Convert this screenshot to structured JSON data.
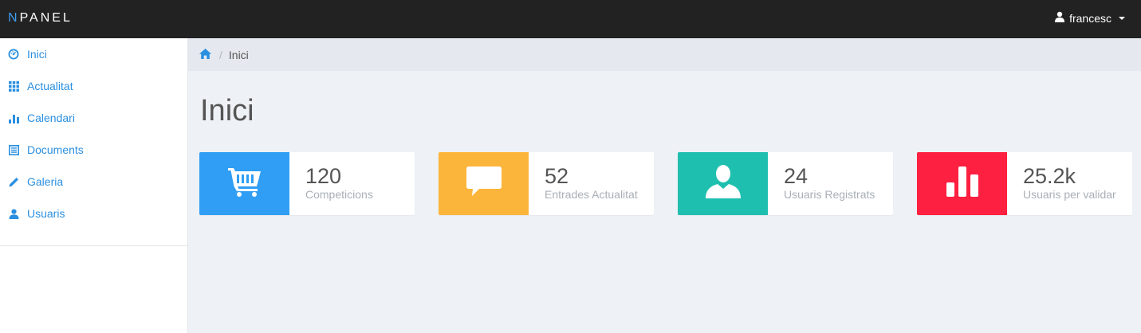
{
  "brand": {
    "first_letter": "N",
    "rest": "PANEL",
    "accent_color": "#3d9df0"
  },
  "user": {
    "name": "francesc",
    "icon": "user-icon"
  },
  "sidebar": {
    "items": [
      {
        "label": "Inici",
        "icon": "dashboard-icon"
      },
      {
        "label": "Actualitat",
        "icon": "grid-icon"
      },
      {
        "label": "Calendari",
        "icon": "bar-chart-icon"
      },
      {
        "label": "Documents",
        "icon": "list-icon"
      },
      {
        "label": "Galeria",
        "icon": "pencil-icon"
      },
      {
        "label": "Usuaris",
        "icon": "user-icon"
      }
    ]
  },
  "breadcrumb": {
    "home_icon": "home-icon",
    "separator": "/",
    "current": "Inici"
  },
  "page": {
    "title": "Inici"
  },
  "stats": [
    {
      "value": "120",
      "label": "Competicions",
      "icon": "cart-icon",
      "color": "#2f9ef4"
    },
    {
      "value": "52",
      "label": "Entrades Actualitat",
      "icon": "comment-icon",
      "color": "#fcb53b"
    },
    {
      "value": "24",
      "label": "Usuaris Registrats",
      "icon": "user-icon",
      "color": "#1fbfaf"
    },
    {
      "value": "25.2k",
      "label": "Usuaris per validar",
      "icon": "bar-chart-icon",
      "color": "#fd2040"
    }
  ]
}
